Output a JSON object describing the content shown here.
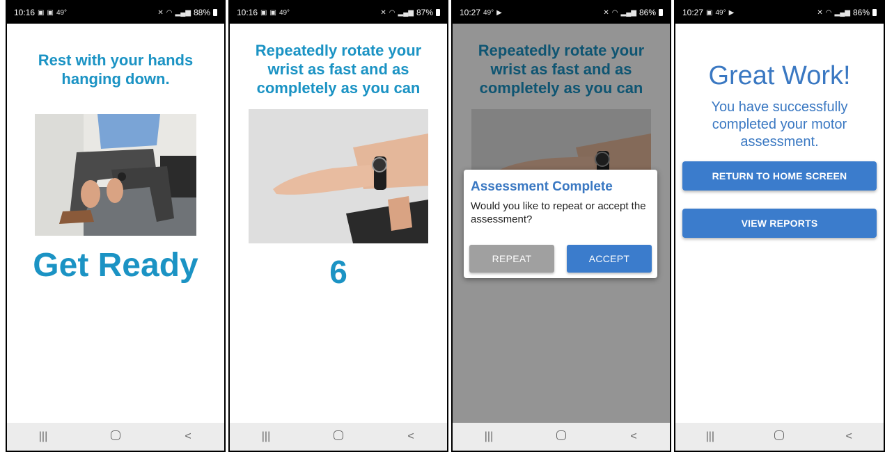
{
  "screens": [
    {
      "status": {
        "time": "10:16",
        "temp": "49°",
        "battery": "88%"
      },
      "instruction": "Rest with your hands hanging down.",
      "big_text": "Get Ready"
    },
    {
      "status": {
        "time": "10:16",
        "temp": "49°",
        "battery": "87%"
      },
      "instruction": "Repeatedly rotate your wrist as fast and as completely as you can",
      "countdown": "6"
    },
    {
      "status": {
        "time": "10:27",
        "temp": "49°",
        "battery": "86%"
      },
      "instruction": "Repeatedly rotate your wrist as fast and as completely as you can",
      "dialog": {
        "title": "Assessment Complete",
        "message": "Would you like to repeat or accept the assessment?",
        "repeat_label": "REPEAT",
        "accept_label": "ACCEPT"
      }
    },
    {
      "status": {
        "time": "10:27",
        "temp": "49°",
        "battery": "86%"
      },
      "heading": "Great Work!",
      "message": "You have successfully completed your motor assessment.",
      "home_button_label": "RETURN TO HOME SCREEN",
      "reports_button_label": "VIEW REPORTS"
    }
  ],
  "nav": {
    "recents": "|||",
    "home": "○",
    "back": "<"
  },
  "icons": {
    "gallery": "gallery-icon",
    "mute": "mute-icon",
    "wifi": "wifi-icon",
    "signal": "signal-icon",
    "play": "play-icon"
  },
  "colors": {
    "accent_text": "#1b93c4",
    "button_blue": "#3b7ccc",
    "button_gray": "#9e9e9e",
    "dialog_title": "#3a78c2"
  }
}
